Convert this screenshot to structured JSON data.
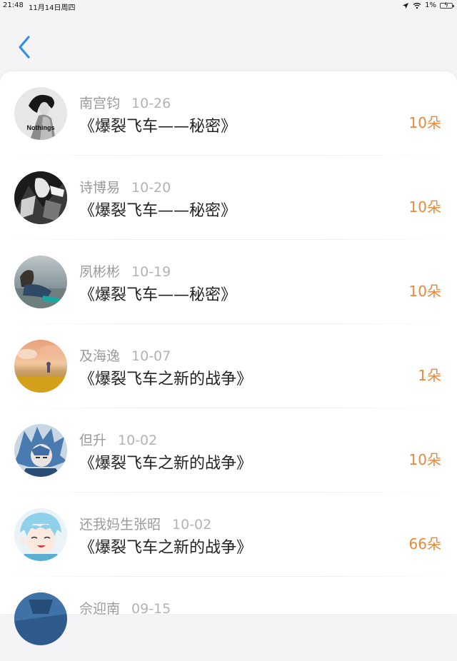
{
  "status_bar": {
    "time": "21:48",
    "date": "11月14日周四",
    "battery": "1%"
  },
  "nav": {
    "back_icon": "chevron-left-icon",
    "accent": "#2f8fe8"
  },
  "colors": {
    "amount": "#e58a3c",
    "muted": "#9a9a9a"
  },
  "rows": [
    {
      "name": "南宫钧",
      "date": "10-26",
      "title": "《爆裂飞车——秘密》",
      "amount": "10朵",
      "avatar_text": "Nothings"
    },
    {
      "name": "诗博易",
      "date": "10-20",
      "title": "《爆裂飞车——秘密》",
      "amount": "10朵"
    },
    {
      "name": "夙彬彬",
      "date": "10-19",
      "title": "《爆裂飞车——秘密》",
      "amount": "10朵"
    },
    {
      "name": "及海逸",
      "date": "10-07",
      "title": "《爆裂飞车之新的战争》",
      "amount": "1朵"
    },
    {
      "name": "但升",
      "date": "10-02",
      "title": "《爆裂飞车之新的战争》",
      "amount": "10朵"
    },
    {
      "name": "还我妈生张昭",
      "date": "10-02",
      "title": "《爆裂飞车之新的战争》",
      "amount": "66朵"
    },
    {
      "name": "佘迎南",
      "date": "09-15",
      "title": "",
      "amount": ""
    }
  ]
}
